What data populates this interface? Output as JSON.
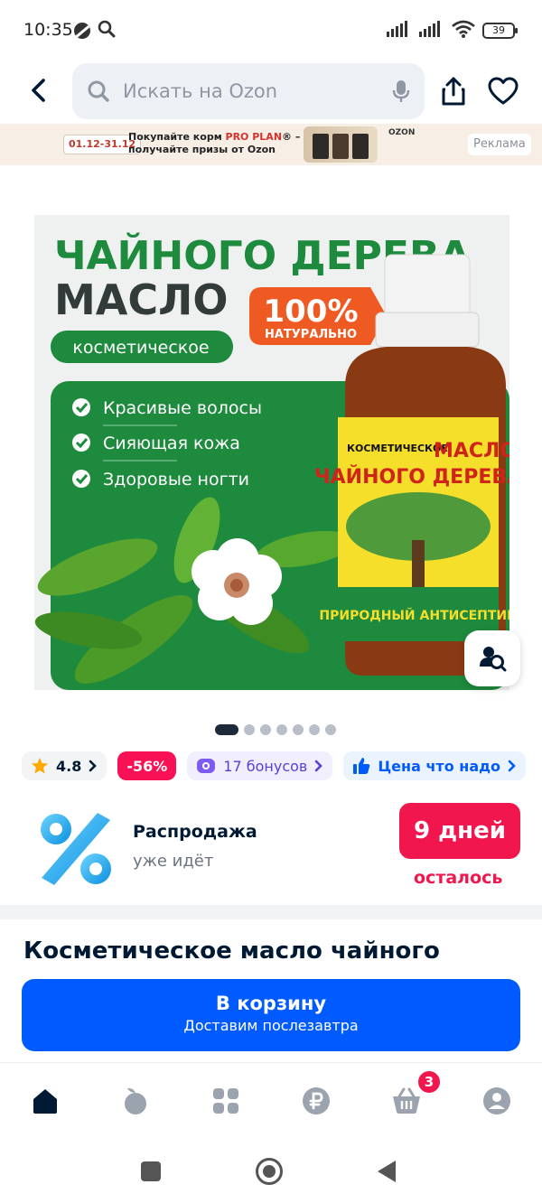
{
  "status_bar": {
    "time": "10:35",
    "battery": "39"
  },
  "header": {
    "search_placeholder": "Искать на Ozon"
  },
  "ad_banner": {
    "dates": "01.12-31.12",
    "line1_prefix": "Покупайте корм ",
    "line1_brand": "PRO PLAN",
    "line1_suffix": "® –",
    "line2": "получайте призы от Ozon",
    "logo": "OZON",
    "tag": "Реклама"
  },
  "product_image": {
    "headline1": "ЧАЙНОГО ДЕРЕВА",
    "headline2": "МАСЛО",
    "pill": "косметическое",
    "badge_big": "100%",
    "badge_small": "НАТУРАЛЬНО",
    "benefits": [
      "Красивые волосы",
      "Сияющая кожа",
      "Здоровые ногти"
    ],
    "label_top_left": "КОСМЕТИЧЕСКОЕ",
    "label_top_right": "МАСЛО",
    "label_main": "ЧАЙНОГО ДЕРЕВА",
    "label_bottom": "ПРИРОДНЫЙ АНТИСЕПТИК"
  },
  "gallery": {
    "total": 7,
    "active_index": 0
  },
  "chips": {
    "rating": "4.8",
    "discount": "-56%",
    "bonus": "17 бонусов",
    "price_label": "Цена что надо"
  },
  "sale": {
    "title": "Распродажа",
    "subtitle": "уже идёт",
    "days": "9 дней",
    "days_left": "осталось"
  },
  "product": {
    "title": "Косметическое масло чайного"
  },
  "cart_button": {
    "label": "В корзину",
    "sub": "Доставим послезавтра"
  },
  "bottom_nav": {
    "cart_badge": "3"
  },
  "colors": {
    "ozon_blue": "#005bff",
    "sale_pink": "#f1174e",
    "product_green": "#1e8a3d"
  }
}
